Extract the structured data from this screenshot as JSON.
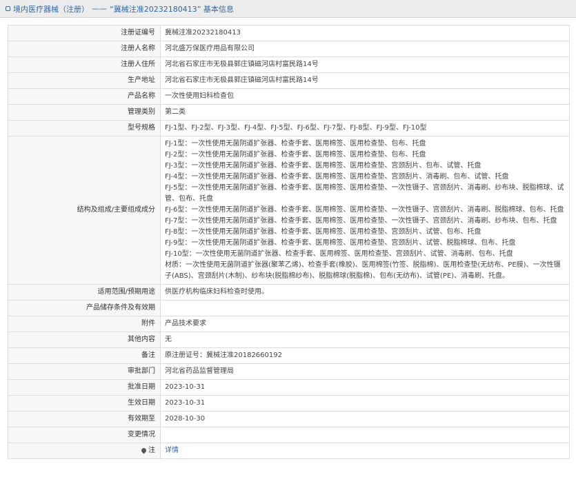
{
  "header": {
    "crumb1": "境内医疗器械（注册）",
    "dash": "——",
    "crumb2": "“冀械注准20232180413” 基本信息"
  },
  "rows": {
    "reg_no": {
      "label": "注册证编号",
      "value": "冀械注准20232180413"
    },
    "registrant": {
      "label": "注册人名称",
      "value": "河北盛万保医疗用品有限公司"
    },
    "registrant_addr": {
      "label": "注册人住所",
      "value": "河北省石家庄市无极县郭庄镇磁河店村富民路14号"
    },
    "prod_addr": {
      "label": "生产地址",
      "value": "河北省石家庄市无极县郭庄镇磁河店村富民路14号"
    },
    "product_name": {
      "label": "产品名称",
      "value": "一次性使用妇科检查包"
    },
    "category": {
      "label": "管理类别",
      "value": "第二类"
    },
    "models": {
      "label": "型号规格",
      "value": "FJ-1型、FJ-2型、FJ-3型、FJ-4型、FJ-5型、FJ-6型、FJ-7型、FJ-8型、FJ-9型、FJ-10型"
    },
    "structure": {
      "label": "结构及组成/主要组成成分",
      "lines": [
        "FJ-1型：一次性使用无菌阴道扩张器、检查手套、医用棉签、医用检查垫、包布、托盘",
        "FJ-2型：一次性使用无菌阴道扩张器、检查手套、医用棉签、医用检查垫、包布、托盘",
        "FJ-3型：一次性使用无菌阴道扩张器、检查手套、医用棉签、医用检查垫、宫颈刮片、包布、试管、托盘",
        "FJ-4型：一次性使用无菌阴道扩张器、检查手套、医用棉签、医用检查垫、宫颈刮片、消毒刷、包布、试管、托盘",
        "FJ-5型：一次性使用无菌阴道扩张器、检查手套、医用棉签、医用检查垫、一次性镊子、宫颈刮片、消毒刷、纱布块、脱脂棉球、试管、包布、托盘",
        "FJ-6型：一次性使用无菌阴道扩张器、检查手套、医用棉签、医用检查垫、一次性镊子、宫颈刮片、消毒刷、脱脂棉球、包布、托盘",
        "FJ-7型：一次性使用无菌阴道扩张器、检查手套、医用棉签、医用检查垫、一次性镊子、宫颈刮片、消毒刷、纱布块、包布、托盘",
        "FJ-8型：一次性使用无菌阴道扩张器、检查手套、医用棉签、医用检查垫、宫颈刮片、试管、包布、托盘",
        "FJ-9型：一次性使用无菌阴道扩张器、检查手套、医用棉签、医用检查垫、宫颈刮片、试管、脱脂棉球、包布、托盘",
        "FJ-10型：一次性使用无菌阴道扩张器、检查手套、医用棉签、医用检查垫、宫颈刮片、试管、消毒刷、包布、托盘",
        "材质：一次性使用无菌阴道扩张器(聚苯乙烯)、检查手套(橡胶)、医用棉签(竹签、脱脂棉)、医用检查垫(无纺布、PE膜)、一次性镊子(ABS)、宫颈刮片(木制)、纱布块(脱脂棉纱布)、脱脂棉球(脱脂棉)、包布(无纺布)、试管(PE)、消毒刷、托盘。"
      ]
    },
    "scope": {
      "label": "适用范围/预期用途",
      "value": "供医疗机构临床妇科检查时使用。"
    },
    "storage": {
      "label": "产品储存条件及有效期",
      "value": ""
    },
    "attachment": {
      "label": "附件",
      "value": "产品技术要求"
    },
    "other": {
      "label": "其他内容",
      "value": "无"
    },
    "remark": {
      "label": "备注",
      "value": "原注册证号：冀械注准20182660192"
    },
    "dept": {
      "label": "审批部门",
      "value": "河北省药品监督管理局"
    },
    "approve_date": {
      "label": "批准日期",
      "value": "2023-10-31"
    },
    "effective_date": {
      "label": "生效日期",
      "value": "2023-10-31"
    },
    "expire_date": {
      "label": "有效期至",
      "value": "2028-10-30"
    },
    "change": {
      "label": "变更情况",
      "value": ""
    },
    "note": {
      "label": "注",
      "value": "详情"
    }
  }
}
